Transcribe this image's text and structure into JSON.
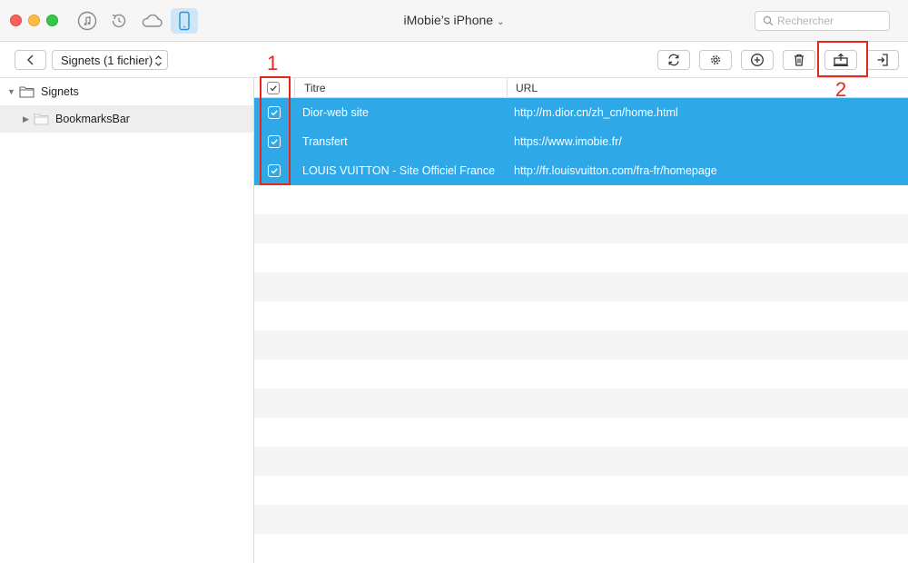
{
  "window": {
    "title": "iMobie’s iPhone",
    "title_caret": "⌄",
    "search_placeholder": "Rechercher"
  },
  "mode_tabs": [
    {
      "icon": "music-note-icon"
    },
    {
      "icon": "history-icon"
    },
    {
      "icon": "cloud-icon"
    },
    {
      "icon": "phone-icon",
      "active": true
    }
  ],
  "toolbar": {
    "folder_select": "Signets (1 fichier)",
    "actions": [
      "refresh-icon",
      "gear-icon",
      "add-icon",
      "trash-icon",
      "export-to-computer-icon",
      "send-to-device-icon"
    ]
  },
  "sidebar": {
    "root_label": "Signets",
    "child_label": "BookmarksBar"
  },
  "table": {
    "columns": [
      "Titre",
      "URL"
    ],
    "rows": [
      {
        "title": "Dior-web site",
        "url": "http://m.dior.cn/zh_cn/home.html"
      },
      {
        "title": "Transfert",
        "url": "https://www.imobie.fr/"
      },
      {
        "title": "LOUIS VUITTON - Site Officiel France",
        "url": "http://fr.louisvuitton.com/fra-fr/homepage"
      }
    ]
  },
  "annotations": {
    "label_1": "1",
    "label_2": "2",
    "color": "#e8271b"
  },
  "colors": {
    "selection": "#2fa8e8",
    "active_tab": "#cfe6f8"
  }
}
